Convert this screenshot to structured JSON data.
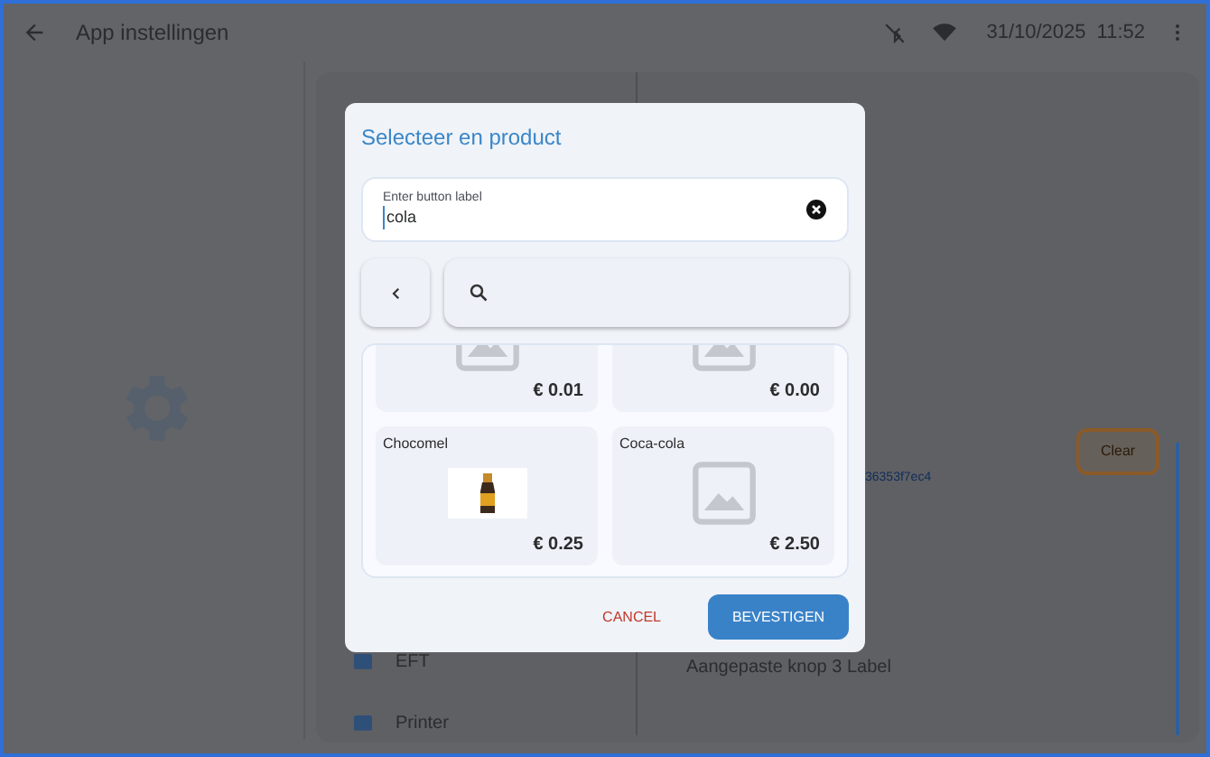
{
  "app_bar": {
    "title": "App instellingen",
    "date": "31/10/2025",
    "time": "11:52"
  },
  "background": {
    "menu_items": [
      {
        "label": "EFT"
      },
      {
        "label": "Printer"
      }
    ],
    "link": "36353f7ec4",
    "custom_button_label": "Aangepaste knop 3 Label",
    "clear_button": "Clear"
  },
  "dialog": {
    "title": "Selecteer en product",
    "label_field": {
      "label": "Enter button label",
      "value": "cola"
    },
    "products": [
      {
        "price": "€ 0.01",
        "kind": "placeholder"
      },
      {
        "price": "€ 0.00",
        "kind": "placeholder"
      },
      {
        "name": "Chocomel",
        "price": "€ 0.25"
      },
      {
        "name": "Coca-cola",
        "price": "€ 2.50",
        "kind": "placeholder"
      }
    ],
    "buttons": {
      "cancel": "CANCEL",
      "confirm": "BEVESTIGEN"
    }
  }
}
